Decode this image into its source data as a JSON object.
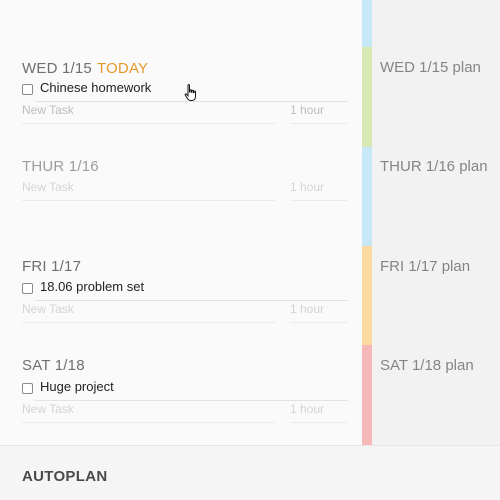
{
  "days": [
    {
      "date_label": "WED 1/15",
      "today_badge": "TODAY",
      "tasks": [
        {
          "label": "Chinese homework"
        }
      ],
      "new_task_placeholder": "New Task",
      "duration_placeholder": "1 hour",
      "plan_label": "WED 1/15 plan"
    },
    {
      "date_label": "THUR 1/16",
      "tasks": [],
      "new_task_placeholder": "New Task",
      "duration_placeholder": "1 hour",
      "plan_label": "THUR 1/16 plan"
    },
    {
      "date_label": "FRI 1/17",
      "tasks": [
        {
          "label": "18.06 problem set"
        }
      ],
      "new_task_placeholder": "New Task",
      "duration_placeholder": "1 hour",
      "plan_label": "FRI 1/17 plan"
    },
    {
      "date_label": "SAT 1/18",
      "tasks": [
        {
          "label": "Huge project"
        }
      ],
      "new_task_placeholder": "New Task",
      "duration_placeholder": "1 hour",
      "plan_label": "SAT 1/18 plan"
    }
  ],
  "footer": {
    "title": "AUTOPLAN"
  },
  "colors": {
    "today_accent": "#e39a2e",
    "bar_blue": "#c7e9f7",
    "bar_green": "#d8e8b4",
    "bar_orange": "#fbd9a0",
    "bar_pink": "#f6b8b8"
  },
  "icons": {
    "cursor": "hand-pointer-icon",
    "checkbox": "checkbox-icon"
  }
}
